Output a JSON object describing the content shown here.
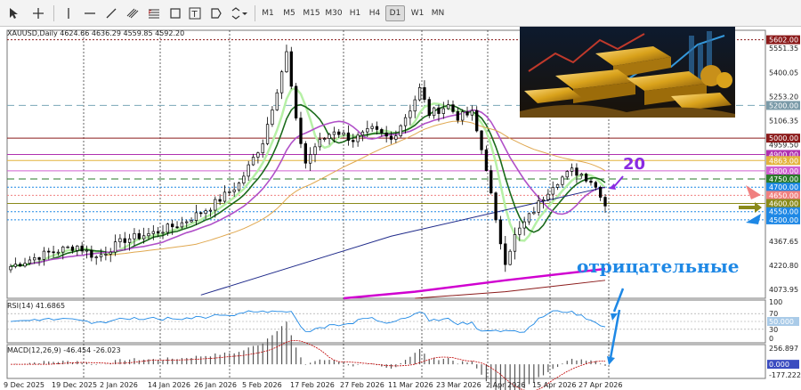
{
  "toolbar": {
    "timeframes": [
      "M1",
      "M5",
      "M15",
      "M30",
      "H1",
      "H4",
      "D1",
      "W1",
      "MN"
    ],
    "active_timeframe": "D1"
  },
  "chart": {
    "header": "XAUUSD,Daily  4624.66 4636.29 4559.85 4592.20",
    "price_axis": [
      "5551.35",
      "5400.05",
      "5253.20",
      "5106.35",
      "4959.50",
      "4367.65",
      "4220.80",
      "4073.95"
    ],
    "price_tags": [
      {
        "label": "5602.00",
        "price": 5602,
        "color": "#8b1a1a"
      },
      {
        "label": "5200.00",
        "price": 5200,
        "color": "#7a9aa8"
      },
      {
        "label": "5000.00",
        "price": 5000,
        "color": "#8b1a1a"
      },
      {
        "label": "4900.00",
        "price": 4900,
        "color": "#b030b0"
      },
      {
        "label": "4863.00",
        "price": 4863,
        "color": "#e3b33c"
      },
      {
        "label": "4800.00",
        "price": 4800,
        "color": "#d060d0"
      },
      {
        "label": "4750.00",
        "price": 4750,
        "color": "#2a7a2a"
      },
      {
        "label": "4700.00",
        "price": 4700,
        "color": "#1e88e5"
      },
      {
        "label": "4650.00",
        "price": 4650,
        "color": "#f08080"
      },
      {
        "label": "4600.00",
        "price": 4600,
        "color": "#8a8a1a"
      },
      {
        "label": "4550.00",
        "price": 4550,
        "color": "#1e88e5"
      },
      {
        "label": "4500.00",
        "price": 4500,
        "color": "#1e88e5"
      }
    ],
    "annotations": {
      "number": "20",
      "negative_text": "отрицательные"
    },
    "date_axis": [
      "9 Dec 2025",
      "19 Dec 2025",
      "2 Jan 2026",
      "14 Jan 2026",
      "26 Jan 2026",
      "5 Feb 2026",
      "17 Feb 2026",
      "27 Feb 2026",
      "11 Mar 2026",
      "23 Mar 2026",
      "2 Apr 2026",
      "15 Apr 2026",
      "27 Apr 2026"
    ]
  },
  "rsi": {
    "header": "RSI(14) 41.6865",
    "levels": [
      "100",
      "70",
      "50.000",
      "30",
      "0"
    ]
  },
  "macd": {
    "header": "MACD(12,26,9) -46.454 -26.023",
    "levels": [
      "256.897",
      "0.000",
      "-177.222"
    ]
  },
  "chart_data": {
    "type": "candlestick",
    "title": "XAUUSD,Daily",
    "x": [
      "9 Dec 2025",
      "19 Dec 2025",
      "2 Jan 2026",
      "14 Jan 2026",
      "26 Jan 2026",
      "5 Feb 2026",
      "17 Feb 2026",
      "27 Feb 2026",
      "11 Mar 2026",
      "23 Mar 2026",
      "2 Apr 2026",
      "15 Apr 2026",
      "27 Apr 2026"
    ],
    "close_approx": [
      4230,
      4340,
      4420,
      4600,
      5300,
      4950,
      4980,
      5150,
      5000,
      4300,
      4720,
      4800,
      4592
    ],
    "ylim": [
      4020,
      5660
    ],
    "last": {
      "open": 4624.66,
      "high": 4636.29,
      "low": 4559.85,
      "close": 4592.2
    }
  }
}
